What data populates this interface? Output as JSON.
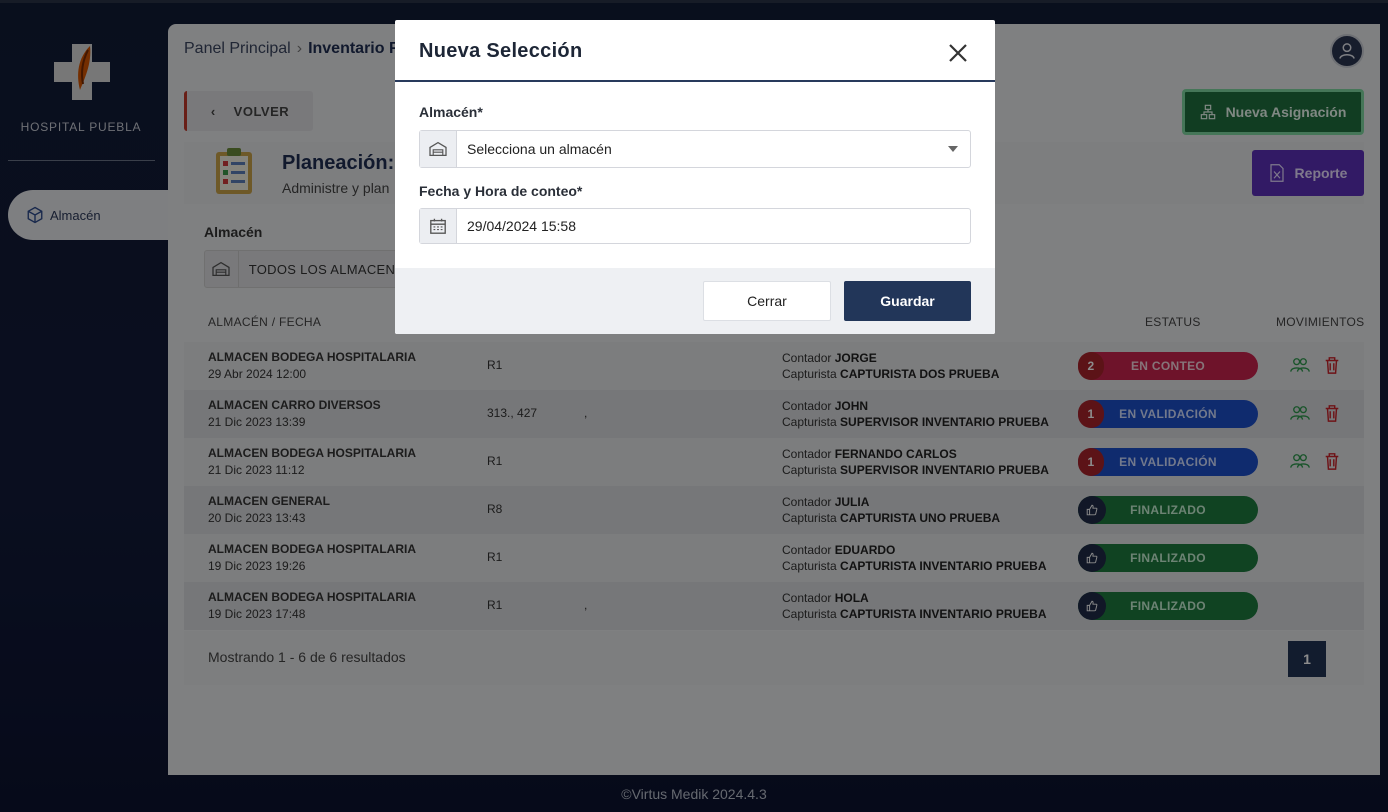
{
  "sidebar": {
    "hospital_name": "HOSPITAL PUEBLA",
    "items": [
      {
        "label": "Almacén",
        "icon": "box-icon"
      }
    ]
  },
  "breadcrumb": [
    "Panel Principal",
    "Inventario F"
  ],
  "toolbar": {
    "back_label": "VOLVER",
    "new_assignment_label": "Nueva Asignación",
    "report_label": "Reporte"
  },
  "header": {
    "title": "Planeación: .",
    "subtitle": "Administre y plan"
  },
  "filter": {
    "label": "Almacén",
    "value": "TODOS LOS ALMACENE"
  },
  "table": {
    "columns": {
      "warehouse_date": "ALMACÉN / FECHA",
      "status": "ESTATUS",
      "movements": "MOVIMIENTOS"
    },
    "rows": [
      {
        "name": "ALMACEN BODEGA HOSPITALARIA",
        "date": "29 Abr 2024 12:00",
        "ref": "R1",
        "extra": "",
        "counter": "JORGE",
        "capturer": "CAPTURISTA DOS PRUEBA",
        "count": "2",
        "status": "EN CONTEO",
        "status_color": "#c8234e"
      },
      {
        "name": "ALMACEN CARRO DIVERSOS",
        "date": "21 Dic 2023 13:39",
        "ref": "313., 427",
        "extra": ",",
        "counter": "JOHN",
        "capturer": "SUPERVISOR INVENTARIO PRUEBA",
        "count": "1",
        "status": "EN VALIDACIÓN",
        "status_color": "#1d4fc8"
      },
      {
        "name": "ALMACEN BODEGA HOSPITALARIA",
        "date": "21 Dic 2023 11:12",
        "ref": "R1",
        "extra": "",
        "counter": "FERNANDO CARLOS",
        "capturer": "SUPERVISOR INVENTARIO PRUEBA",
        "count": "1",
        "status": "EN VALIDACIÓN",
        "status_color": "#1d4fc8"
      },
      {
        "name": "ALMACEN GENERAL",
        "date": "20 Dic 2023 13:43",
        "ref": "R8",
        "extra": "",
        "counter": "JULIA",
        "capturer": "CAPTURISTA UNO PRUEBA",
        "count": "",
        "status": "FINALIZADO",
        "status_color": "#1e7a3f"
      },
      {
        "name": "ALMACEN BODEGA HOSPITALARIA",
        "date": "19 Dic 2023 19:26",
        "ref": "R1",
        "extra": "",
        "counter": "EDUARDO",
        "capturer": "CAPTURISTA INVENTARIO PRUEBA",
        "count": "",
        "status": "FINALIZADO",
        "status_color": "#1e7a3f"
      },
      {
        "name": "ALMACEN BODEGA HOSPITALARIA",
        "date": "19 Dic 2023 17:48",
        "ref": "R1",
        "extra": ",",
        "counter": "HOLA",
        "capturer": "CAPTURISTA INVENTARIO PRUEBA",
        "count": "",
        "status": "FINALIZADO",
        "status_color": "#1e7a3f"
      }
    ],
    "counter_prefix": "Contador",
    "capturer_prefix": "Capturista"
  },
  "pagination": {
    "summary": "Mostrando 1 - 6 de 6 resultados",
    "current_page": "1"
  },
  "footer": {
    "copyright": "©Virtus Medik 2024.4.3"
  },
  "modal": {
    "title": "Nueva Selección",
    "warehouse_label": "Almacén*",
    "warehouse_value": "Selecciona un almacén",
    "datetime_label": "Fecha y Hora de conteo*",
    "datetime_value": "29/04/2024 15:58",
    "close_label": "Cerrar",
    "save_label": "Guardar"
  },
  "colors": {
    "primary": "#223659",
    "success": "#1e7a3f",
    "danger": "#c8234e",
    "info": "#1d4fc8",
    "purple": "#5b31b8"
  }
}
